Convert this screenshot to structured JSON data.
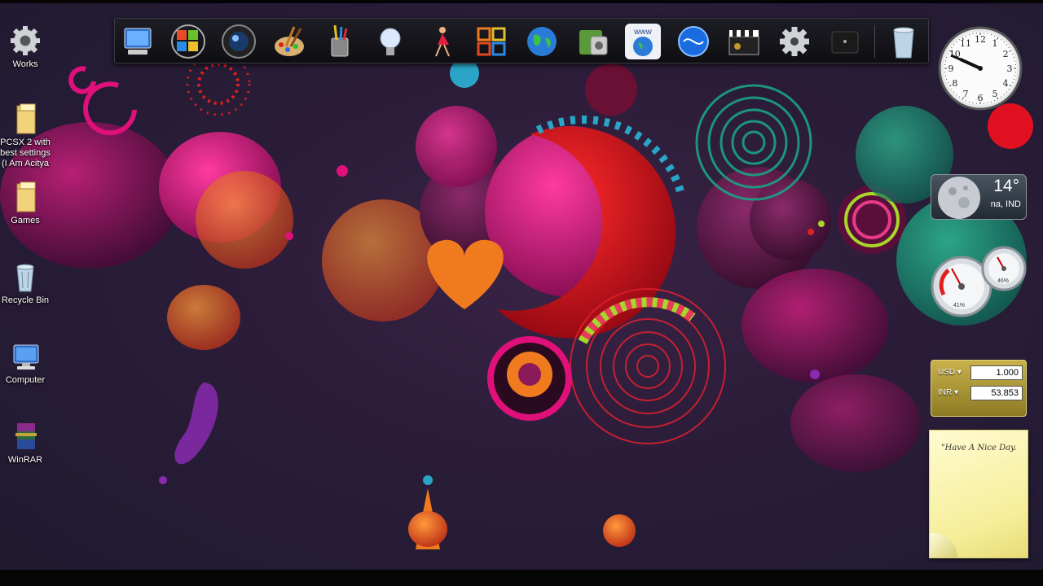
{
  "desktop": {
    "icons": [
      {
        "id": "works",
        "label": "Works",
        "icon": "gear-icon"
      },
      {
        "id": "pcsx2",
        "label": "PCSX 2 with\nbest settings\n(I Am Acitya",
        "icon": "folder-icon"
      },
      {
        "id": "games",
        "label": "Games",
        "icon": "folder-icon"
      },
      {
        "id": "recycle-bin",
        "label": "Recycle Bin",
        "icon": "recycle-bin-icon"
      },
      {
        "id": "computer",
        "label": "Computer",
        "icon": "computer-icon"
      },
      {
        "id": "winrar",
        "label": "WinRAR",
        "icon": "winrar-icon"
      }
    ]
  },
  "dock": {
    "items": [
      {
        "name": "computer-icon"
      },
      {
        "name": "windows-update-icon"
      },
      {
        "name": "camera-lens-icon"
      },
      {
        "name": "paint-brushes-icon"
      },
      {
        "name": "pencil-cup-icon"
      },
      {
        "name": "light-bulb-icon"
      },
      {
        "name": "dancer-icon"
      },
      {
        "name": "office-logo-icon"
      },
      {
        "name": "globe-icon"
      },
      {
        "name": "utilities-icon"
      },
      {
        "name": "www-globe-icon"
      },
      {
        "name": "blue-sphere-icon"
      },
      {
        "name": "clapperboard-icon"
      },
      {
        "name": "settings-gear-icon"
      },
      {
        "name": "dark-app-icon"
      },
      {
        "name": "trash-icon"
      }
    ]
  },
  "gadgets": {
    "clock": {
      "hour": 9,
      "minute": 49,
      "numbers": [
        "12",
        "1",
        "2",
        "3",
        "4",
        "5",
        "6",
        "7",
        "8",
        "9",
        "10",
        "11"
      ]
    },
    "weather": {
      "temperature": "14°",
      "location": "na, IND",
      "icon": "moon-icon"
    },
    "meter": {
      "cpu_percent": "41%",
      "memory_percent": "46%"
    },
    "currency": {
      "from_code": "USD",
      "from_value": "1.000",
      "to_code": "INR",
      "to_value": "53.853"
    },
    "note": {
      "text": "\"Have A Nice Day."
    }
  },
  "colors": {
    "accent": "#e0107a",
    "teal": "#1aa384",
    "orange": "#f07a1e",
    "red": "#e02020"
  }
}
